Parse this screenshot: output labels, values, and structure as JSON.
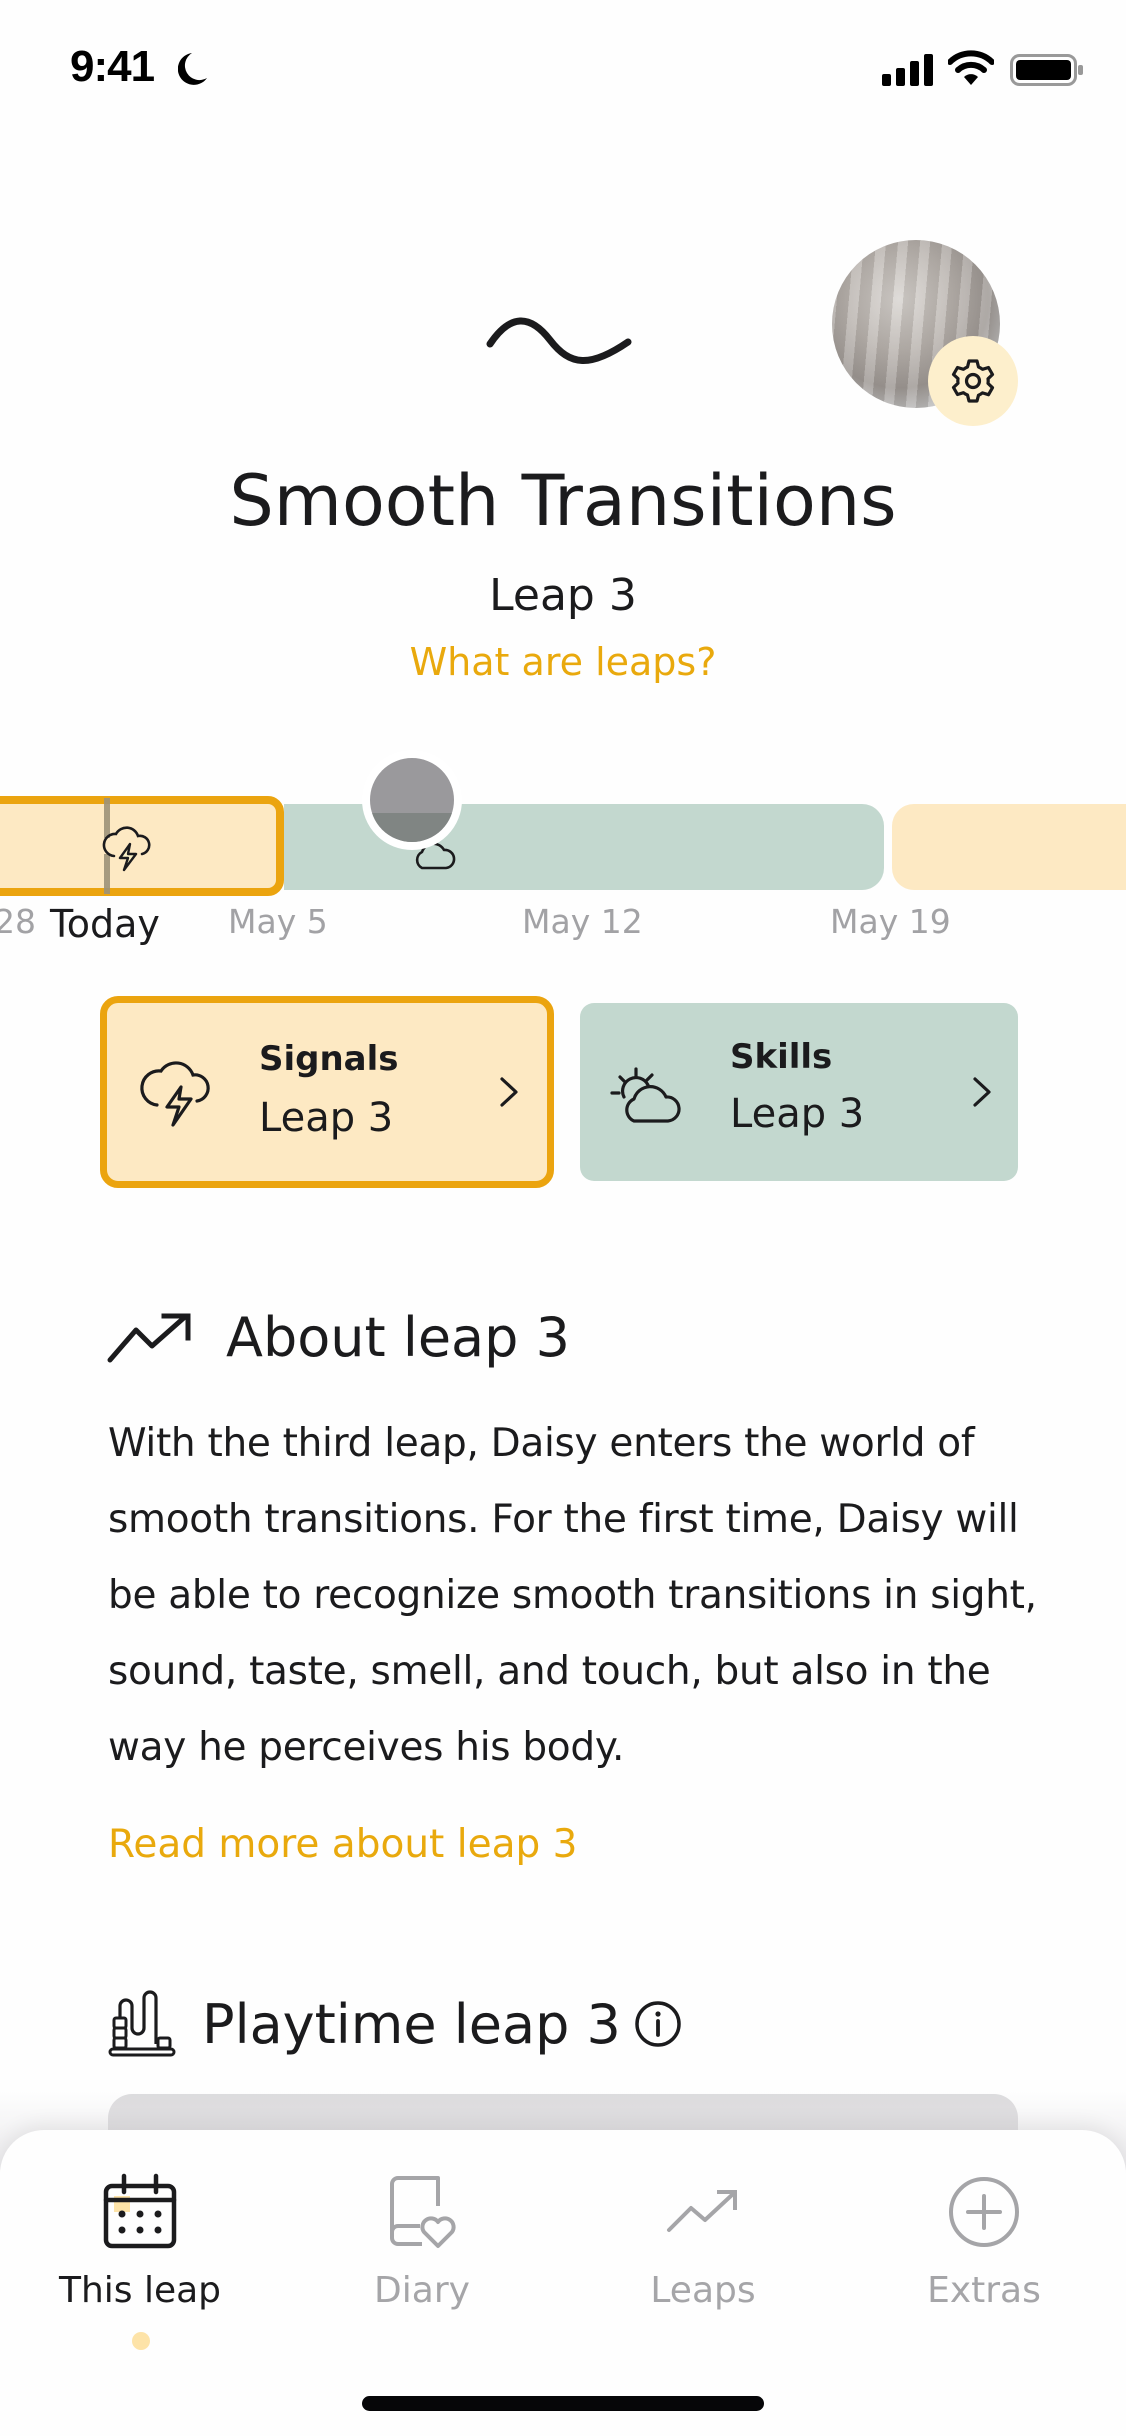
{
  "status_bar": {
    "time": "9:41",
    "focus_icon": "moon-icon",
    "signal_icon": "cellular-signal-icon",
    "wifi_icon": "wifi-icon",
    "battery_icon": "battery-icon"
  },
  "header": {
    "icon": "wave-icon",
    "avatar": "child-avatar",
    "settings_icon": "gear-icon",
    "title": "Smooth Transitions",
    "subtitle": "Leap 3",
    "link": "What are leaps?"
  },
  "timeline": {
    "labels": [
      {
        "text": "28",
        "kind": "date"
      },
      {
        "text": "Today",
        "kind": "today"
      },
      {
        "text": "May 5",
        "kind": "date"
      },
      {
        "text": "May 12",
        "kind": "date"
      },
      {
        "text": "May 19",
        "kind": "date"
      }
    ],
    "segments": [
      {
        "phase": "signals",
        "state": "current"
      },
      {
        "phase": "skills",
        "state": "upcoming"
      },
      {
        "phase": "signals",
        "state": "next"
      }
    ]
  },
  "cards": [
    {
      "label": "Signals",
      "sub": "Leap 3",
      "icon": "storm-cloud-icon"
    },
    {
      "label": "Skills",
      "sub": "Leap 3",
      "icon": "sun-cloud-icon"
    }
  ],
  "about": {
    "title": "About leap 3",
    "body": "With the third leap, Daisy  enters the world of smooth transitions. For the first time, Daisy will be able to recognize smooth transitions in sight, sound, taste, smell, and touch, but also in the way he perceives his body.",
    "read_more": "Read more about leap 3"
  },
  "playtime": {
    "title": "Playtime leap 3"
  },
  "nav": [
    {
      "label": "This leap",
      "icon": "calendar-icon",
      "active": true
    },
    {
      "label": "Diary",
      "icon": "diary-heart-icon",
      "active": false
    },
    {
      "label": "Leaps",
      "icon": "trend-up-icon",
      "active": false
    },
    {
      "label": "Extras",
      "icon": "plus-circle-icon",
      "active": false
    }
  ],
  "colors": {
    "accent": "#eba40f",
    "link": "#e9a90d",
    "signals_bg": "#fde9c3",
    "skills_bg": "#c3d8cf",
    "inactive": "#a5a5a8"
  }
}
